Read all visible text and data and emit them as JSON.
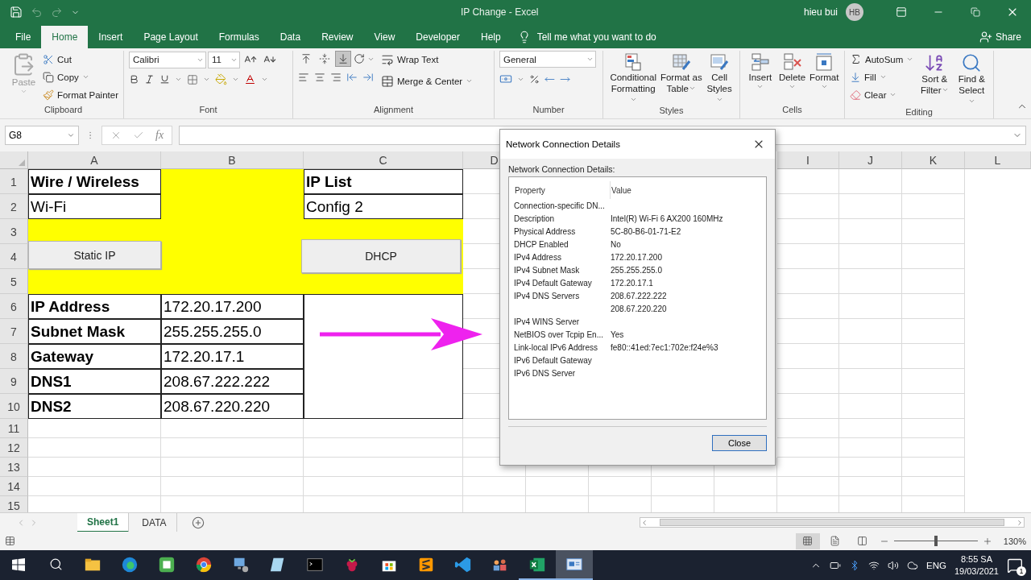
{
  "window": {
    "title": "IP Change  -  Excel",
    "user": "hieu bui",
    "avatar": "HB",
    "undo_disabled": true
  },
  "tabs": [
    {
      "label": "File",
      "selected": false
    },
    {
      "label": "Home",
      "selected": true
    },
    {
      "label": "Insert",
      "selected": false
    },
    {
      "label": "Page Layout",
      "selected": false
    },
    {
      "label": "Formulas",
      "selected": false
    },
    {
      "label": "Data",
      "selected": false
    },
    {
      "label": "Review",
      "selected": false
    },
    {
      "label": "View",
      "selected": false
    },
    {
      "label": "Developer",
      "selected": false
    },
    {
      "label": "Help",
      "selected": false
    }
  ],
  "tell_me": "Tell me what you want to do",
  "share": "Share",
  "ribbon": {
    "clipboard": {
      "label": "Clipboard",
      "paste": {
        "label": "Paste",
        "disabled": true
      },
      "cut": "Cut",
      "copy": "Copy",
      "format_painter": "Format Painter"
    },
    "font": {
      "label": "Font",
      "font_name": "Calibri",
      "font_size": "11"
    },
    "alignment": {
      "label": "Alignment",
      "wrap_text": "Wrap Text",
      "merge": "Merge & Center",
      "vertical_align": [
        {
          "selected": false
        },
        {
          "selected": false
        },
        {
          "selected": true
        }
      ]
    },
    "number": {
      "label": "Number",
      "format": "General"
    },
    "styles": {
      "label": "Styles",
      "buttons": [
        "Conditional Formatting",
        "Format as Table",
        "Cell Styles"
      ]
    },
    "cells": {
      "label": "Cells",
      "buttons": [
        "Insert",
        "Delete",
        "Format"
      ]
    },
    "editing": {
      "label": "Editing",
      "autosum": "AutoSum",
      "fill": "Fill",
      "clear": "Clear",
      "buttons": [
        "Sort & Filter",
        "Find & Select"
      ]
    }
  },
  "formula_bar": {
    "name_box": "G8",
    "function_button": "fx"
  },
  "sheet": {
    "columns": [
      "A",
      "B",
      "C",
      "D",
      "I",
      "J",
      "K",
      "L"
    ],
    "highlight": {
      "color": "#ffff00"
    },
    "rows": [
      {
        "number": "1",
        "cells": [
          {
            "kind": "text",
            "text": "Wire / Wireless",
            "bold": true
          },
          {
            "kind": "highlight"
          },
          {
            "kind": "text",
            "text": "IP List",
            "bold": true
          }
        ]
      },
      {
        "number": "2",
        "cells": [
          {
            "kind": "text",
            "text": "Wi-Fi",
            "bold": false
          },
          {
            "kind": "highlight"
          },
          {
            "kind": "text",
            "text": "Config 2",
            "bold": false
          }
        ]
      },
      {
        "number": "3",
        "cells": [
          {
            "kind": "highlight"
          },
          {
            "kind": "highlight"
          },
          {
            "kind": "highlight"
          }
        ]
      },
      {
        "number": "4",
        "cells": [
          {
            "kind": "highlight"
          },
          {
            "kind": "highlight"
          },
          {
            "kind": "highlight"
          }
        ]
      },
      {
        "number": "5",
        "cells": [
          {
            "kind": "highlight"
          },
          {
            "kind": "highlight"
          },
          {
            "kind": "highlight"
          }
        ]
      },
      {
        "number": "6",
        "cells": [
          {
            "kind": "text",
            "text": "IP Address",
            "bold": true
          },
          {
            "kind": "text",
            "text": "172.20.17.200",
            "bold": false
          },
          {
            "kind": "box"
          }
        ]
      },
      {
        "number": "7",
        "cells": [
          {
            "kind": "text",
            "text": "Subnet Mask",
            "bold": true
          },
          {
            "kind": "text",
            "text": "255.255.255.0",
            "bold": false
          },
          {
            "kind": "box"
          }
        ]
      },
      {
        "number": "8",
        "cells": [
          {
            "kind": "text",
            "text": "Gateway",
            "bold": true
          },
          {
            "kind": "text",
            "text": "172.20.17.1",
            "bold": false
          },
          {
            "kind": "box"
          }
        ]
      },
      {
        "number": "9",
        "cells": [
          {
            "kind": "text",
            "text": "DNS1",
            "bold": true
          },
          {
            "kind": "text",
            "text": "208.67.222.222",
            "bold": false
          },
          {
            "kind": "box"
          }
        ]
      },
      {
        "number": "10",
        "cells": [
          {
            "kind": "text",
            "text": "DNS2",
            "bold": true
          },
          {
            "kind": "text",
            "text": "208.67.220.220",
            "bold": false
          },
          {
            "kind": "box"
          }
        ]
      },
      {
        "number": "11"
      },
      {
        "number": "12"
      },
      {
        "number": "13"
      },
      {
        "number": "14"
      },
      {
        "number": "15"
      }
    ],
    "buttons": [
      {
        "label": "Static IP"
      },
      {
        "label": "DHCP"
      }
    ]
  },
  "dialog": {
    "title": "Network Connection Details",
    "group_label": "Network Connection Details:",
    "columns": [
      "Property",
      "Value"
    ],
    "rows": [
      {
        "property": "Connection-specific DN..."
      },
      {
        "property": "Description",
        "value": "Intel(R) Wi-Fi 6 AX200 160MHz"
      },
      {
        "property": "Physical Address",
        "value": "5C-80-B6-01-71-E2"
      },
      {
        "property": "DHCP Enabled",
        "value": "No"
      },
      {
        "property": "IPv4 Address",
        "value": "172.20.17.200"
      },
      {
        "property": "IPv4 Subnet Mask",
        "value": "255.255.255.0"
      },
      {
        "property": "IPv4 Default Gateway",
        "value": "172.20.17.1"
      },
      {
        "property": "IPv4 DNS Servers",
        "value": "208.67.222.222"
      },
      {
        "value": "208.67.220.220"
      },
      {
        "property": "IPv4 WINS Server"
      },
      {
        "property": "NetBIOS over Tcpip En...",
        "value": "Yes"
      },
      {
        "property": "Link-local IPv6 Address",
        "value": "fe80::41ed:7ec1:702e:f24e%3"
      },
      {
        "property": "IPv6 Default Gateway"
      },
      {
        "property": "IPv6 DNS Server"
      }
    ],
    "close_button": "Close"
  },
  "sheet_tabs": [
    {
      "label": "Sheet1",
      "selected": true
    },
    {
      "label": "DATA",
      "selected": false
    }
  ],
  "status_bar": {
    "views": [
      {
        "selected": true
      },
      {
        "selected": false
      },
      {
        "selected": false
      }
    ],
    "zoom": {
      "level": 0.5
    },
    "zoom_label": "130%"
  },
  "taskbar": {
    "apps": [
      {
        "running": false,
        "selected": false
      },
      {
        "running": false,
        "selected": false
      },
      {
        "running": false,
        "selected": false
      },
      {
        "running": false,
        "selected": false
      },
      {
        "running": false,
        "selected": false
      },
      {
        "running": false,
        "selected": false
      },
      {
        "running": false,
        "selected": false
      },
      {
        "running": false,
        "selected": false
      },
      {
        "running": false,
        "selected": false
      },
      {
        "running": false,
        "selected": false
      },
      {
        "running": false,
        "selected": false
      },
      {
        "running": false,
        "selected": false
      },
      {
        "running": true,
        "selected": false
      },
      {
        "running": true,
        "selected": true
      }
    ],
    "language": "ENG",
    "time": "8:55 SA",
    "date": "19/03/2021",
    "notifications": "1"
  }
}
